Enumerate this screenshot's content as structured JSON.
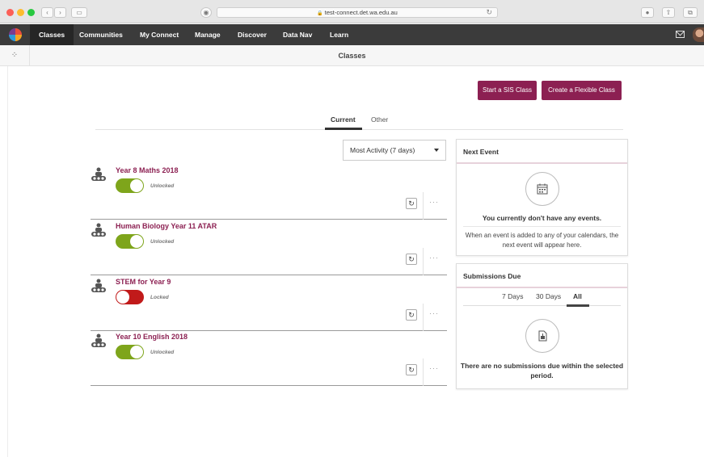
{
  "browser": {
    "url": "test-connect.det.wa.edu.au",
    "lock_glyph": "🔒",
    "reload_glyph": "↻"
  },
  "nav": {
    "items": [
      "Classes",
      "Communities",
      "My Connect",
      "Manage",
      "Discover",
      "Data Nav",
      "Learn"
    ]
  },
  "subheader": {
    "title": "Classes"
  },
  "actions": {
    "sis_label": "Start a SIS Class",
    "flexible_label": "Create a Flexible Class"
  },
  "tabs": {
    "current": "Current",
    "other": "Other"
  },
  "sort": {
    "selected": "Most Activity (7 days)"
  },
  "classes": [
    {
      "name": "Year 8 Maths 2018",
      "status": "Unlocked",
      "locked": false
    },
    {
      "name": "Human Biology Year 11 ATAR",
      "status": "Unlocked",
      "locked": false
    },
    {
      "name": "STEM for Year 9",
      "status": "Locked",
      "locked": true
    },
    {
      "name": "Year 10 English 2018",
      "status": "Unlocked",
      "locked": false
    }
  ],
  "next_event": {
    "title": "Next Event",
    "empty_title": "You currently don't have any events.",
    "empty_text_line1": "When an event is added to any of your calendars, the",
    "empty_text_line2": "next event will appear here."
  },
  "submissions": {
    "title": "Submissions Due",
    "tabs": [
      "7 Days",
      "30 Days",
      "All"
    ],
    "active_tab": "All",
    "empty_line1": "There are no submissions due within the selected",
    "empty_line2": "period."
  },
  "colors": {
    "accent": "#8c2052",
    "toggle_on": "#7ea51b",
    "toggle_off": "#c11a1a",
    "nav_bg": "#3b3b3b"
  }
}
